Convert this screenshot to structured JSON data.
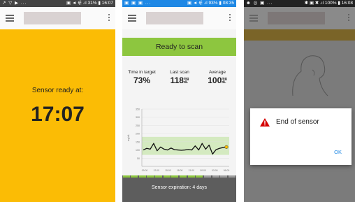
{
  "screens": [
    {
      "status": {
        "left": "↗ ▽ ▶ ...",
        "right": "▣ ◄ ∉ .ıl 31% ▮ 16:07"
      },
      "sensor_ready_label": "Sensor ready at:",
      "sensor_ready_time": "17:07",
      "colors": {
        "background": "#fbbc05"
      }
    },
    {
      "status": {
        "left": "▣ ▣ ▣ ...",
        "right": "▣ ◄ ∉ .ıl 93% ▮ 08:35"
      },
      "banner": "Ready to scan",
      "stats": [
        {
          "label": "Time in target",
          "value": "73%",
          "unit_top": "",
          "unit_bottom": ""
        },
        {
          "label": "Last scan",
          "value": "118",
          "unit_top": "mg",
          "unit_bottom": "dL"
        },
        {
          "label": "Average",
          "value": "100",
          "unit_top": "mg",
          "unit_bottom": "dL"
        }
      ],
      "footer_text": "Sensor expiration: 4 days",
      "colors": {
        "banner": "#8dc63f",
        "footer": "#5d5d5d"
      },
      "chart_data": {
        "type": "line",
        "ylabel": "mg/dL",
        "yticks": [
          "350",
          "300",
          "250",
          "200",
          "150",
          "100",
          "50"
        ],
        "xticks": [
          "09:00",
          "12:00",
          "15:00",
          "18:00",
          "21:00",
          "00:00",
          "03:00",
          "06:00"
        ],
        "ylim": [
          0,
          350
        ],
        "target_range": [
          70,
          180
        ],
        "series": [
          {
            "x": [
              0,
              1,
              2,
              3,
              4,
              5,
              6,
              7,
              8,
              9,
              10,
              11,
              12,
              13,
              14,
              15,
              16,
              17,
              18,
              19,
              20,
              21,
              22,
              23,
              24
            ],
            "y": [
              100,
              110,
              105,
              140,
              95,
              118,
              105,
              100,
              112,
              102,
              100,
              98,
              100,
              103,
              100,
              125,
              100,
              140,
              105,
              130,
              75,
              102,
              110,
              115,
              118
            ]
          }
        ]
      }
    },
    {
      "status": {
        "left": "☻ ◎ ▣ ...",
        "right": "✱ ▣ ✖ .ıl 100% ▮ 16:08"
      },
      "dialog_title": "End of sensor",
      "dialog_button": "OK",
      "colors": {
        "warning": "#d50000",
        "ok": "#1e88e5"
      }
    }
  ]
}
